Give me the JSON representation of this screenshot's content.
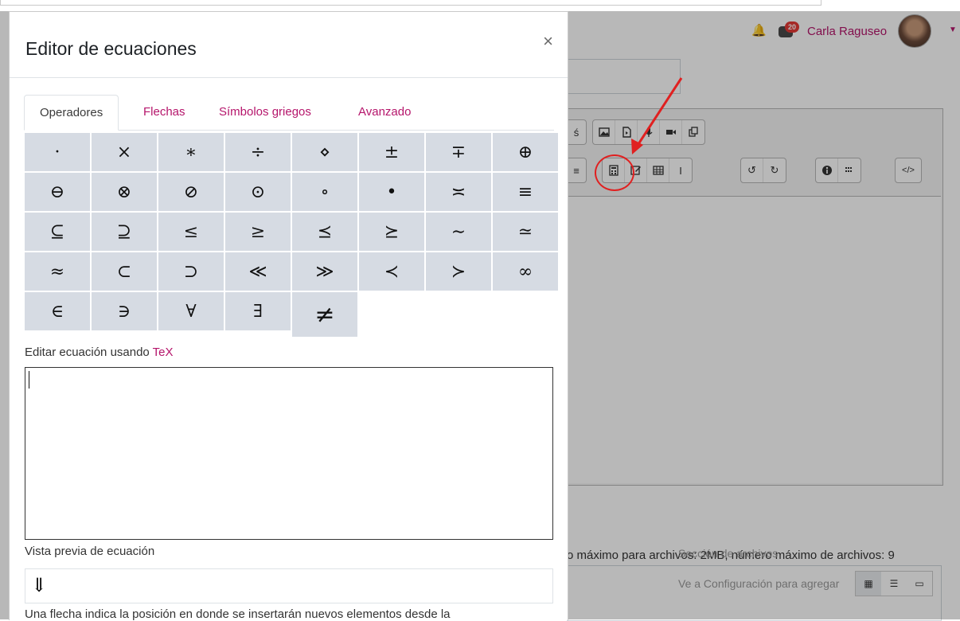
{
  "header": {
    "notifications_count": "20",
    "user_name": "Carla Raguseo"
  },
  "background": {
    "file_limits": "o máximo para archivos: 2MB, número máximo de archivos: 9",
    "ghost_text_1": "Sección de archivos",
    "ghost_text_2": "Ve a Configuración para agregar"
  },
  "modal": {
    "title": "Editor de ecuaciones",
    "close_symbol": "×",
    "tabs": [
      {
        "label": "Operadores",
        "active": true
      },
      {
        "label": "Flechas",
        "active": false
      },
      {
        "label": "Símbolos griegos",
        "active": false
      },
      {
        "label": "Avanzado",
        "active": false
      }
    ],
    "operators": [
      [
        "·",
        "×",
        "∗",
        "÷",
        "⋄",
        "±",
        "∓",
        "⊕"
      ],
      [
        "⊖",
        "⊗",
        "⊘",
        "⊙",
        "∘",
        "•",
        "≍",
        "≡"
      ],
      [
        "⊆",
        "⊇",
        "≤",
        "≥",
        "⪯",
        "⪰",
        "∼",
        "≃"
      ],
      [
        "≈",
        "⊂",
        "⊃",
        "≪",
        "≫",
        "≺",
        "≻",
        "∞"
      ],
      [
        "∈",
        "∋",
        "∀",
        "∃",
        "≠"
      ]
    ],
    "tex_label_prefix": "Editar ecuación usando ",
    "tex_link": "TeX",
    "tex_value": "",
    "preview_label": "Vista previa de ecuación",
    "preview_symbol": "⇓",
    "note": "Una flecha indica la posición en donde se insertarán nuevos elementos desde la"
  },
  "colors": {
    "accent": "#b5156b",
    "cell_bg": "#d6dbe3",
    "annotation": "#e02020"
  }
}
